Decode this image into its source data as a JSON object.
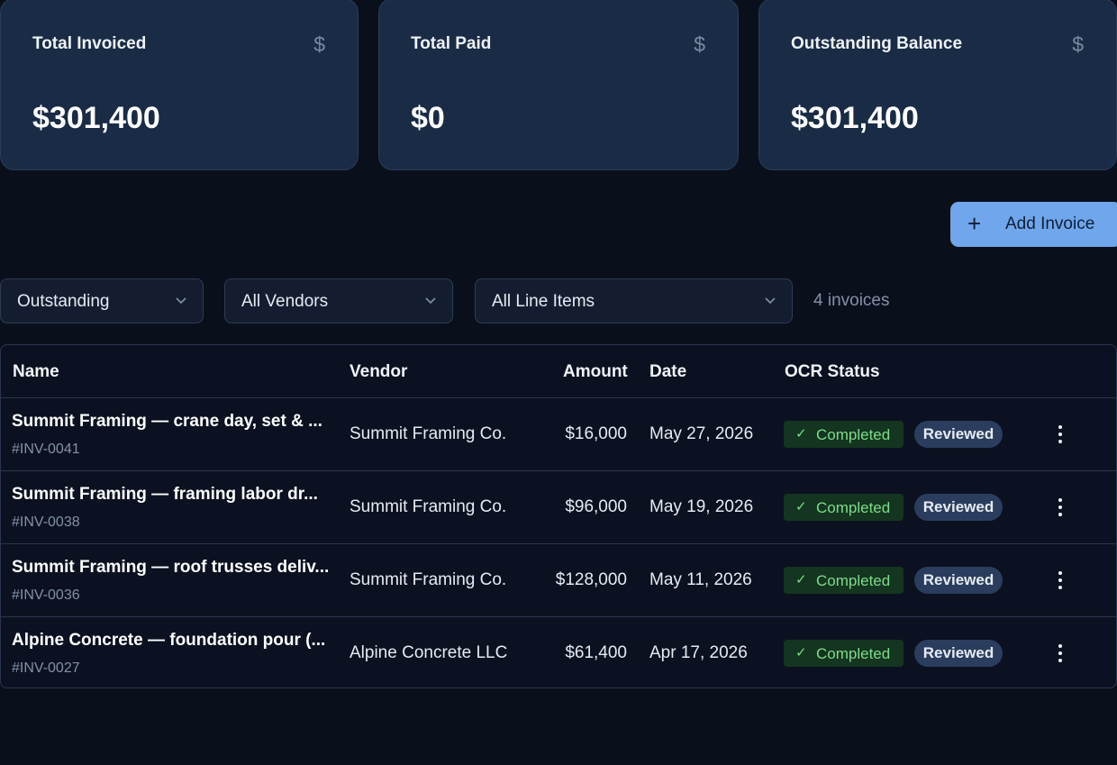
{
  "summary": {
    "cards": [
      {
        "title": "Total Invoiced",
        "icon": "dollar-icon",
        "value": "$301,400"
      },
      {
        "title": "Total Paid",
        "icon": "dollar-icon",
        "value": "$0"
      },
      {
        "title": "Outstanding Balance",
        "icon": "dollar-icon",
        "value": "$301,400"
      }
    ],
    "icon_glyph": "$"
  },
  "actions": {
    "add_invoice_label": "Add Invoice",
    "add_invoice_icon": "plus-icon"
  },
  "filters": {
    "status": "Outstanding",
    "vendor": "All Vendors",
    "line_items": "All Line Items",
    "count_text": "4 invoices"
  },
  "table": {
    "columns": {
      "name": "Name",
      "vendor": "Vendor",
      "amount": "Amount",
      "date": "Date",
      "ocr_status": "OCR Status"
    },
    "rows": [
      {
        "name": "Summit Framing — crane day, set & ...",
        "id": "#INV-0041",
        "vendor": "Summit Framing Co.",
        "amount": "$16,000",
        "date": "May 27, 2026",
        "ocr": "Completed",
        "review": "Reviewed"
      },
      {
        "name": "Summit Framing — framing labor dr...",
        "id": "#INV-0038",
        "vendor": "Summit Framing Co.",
        "amount": "$96,000",
        "date": "May 19, 2026",
        "ocr": "Completed",
        "review": "Reviewed"
      },
      {
        "name": "Summit Framing — roof trusses deliv...",
        "id": "#INV-0036",
        "vendor": "Summit Framing Co.",
        "amount": "$128,000",
        "date": "May 11, 2026",
        "ocr": "Completed",
        "review": "Reviewed"
      },
      {
        "name": "Alpine Concrete — foundation pour (...",
        "id": "#INV-0027",
        "vendor": "Alpine Concrete LLC",
        "amount": "$61,400",
        "date": "Apr 17, 2026",
        "ocr": "Completed",
        "review": "Reviewed"
      }
    ]
  },
  "colors": {
    "background": "#0a0f1c",
    "card": "#1a2b45",
    "accent": "#6fa6ec",
    "completed_badge": "#14351f",
    "completed_text": "#7ddc8a",
    "reviewed_badge": "#2a3d5e"
  }
}
